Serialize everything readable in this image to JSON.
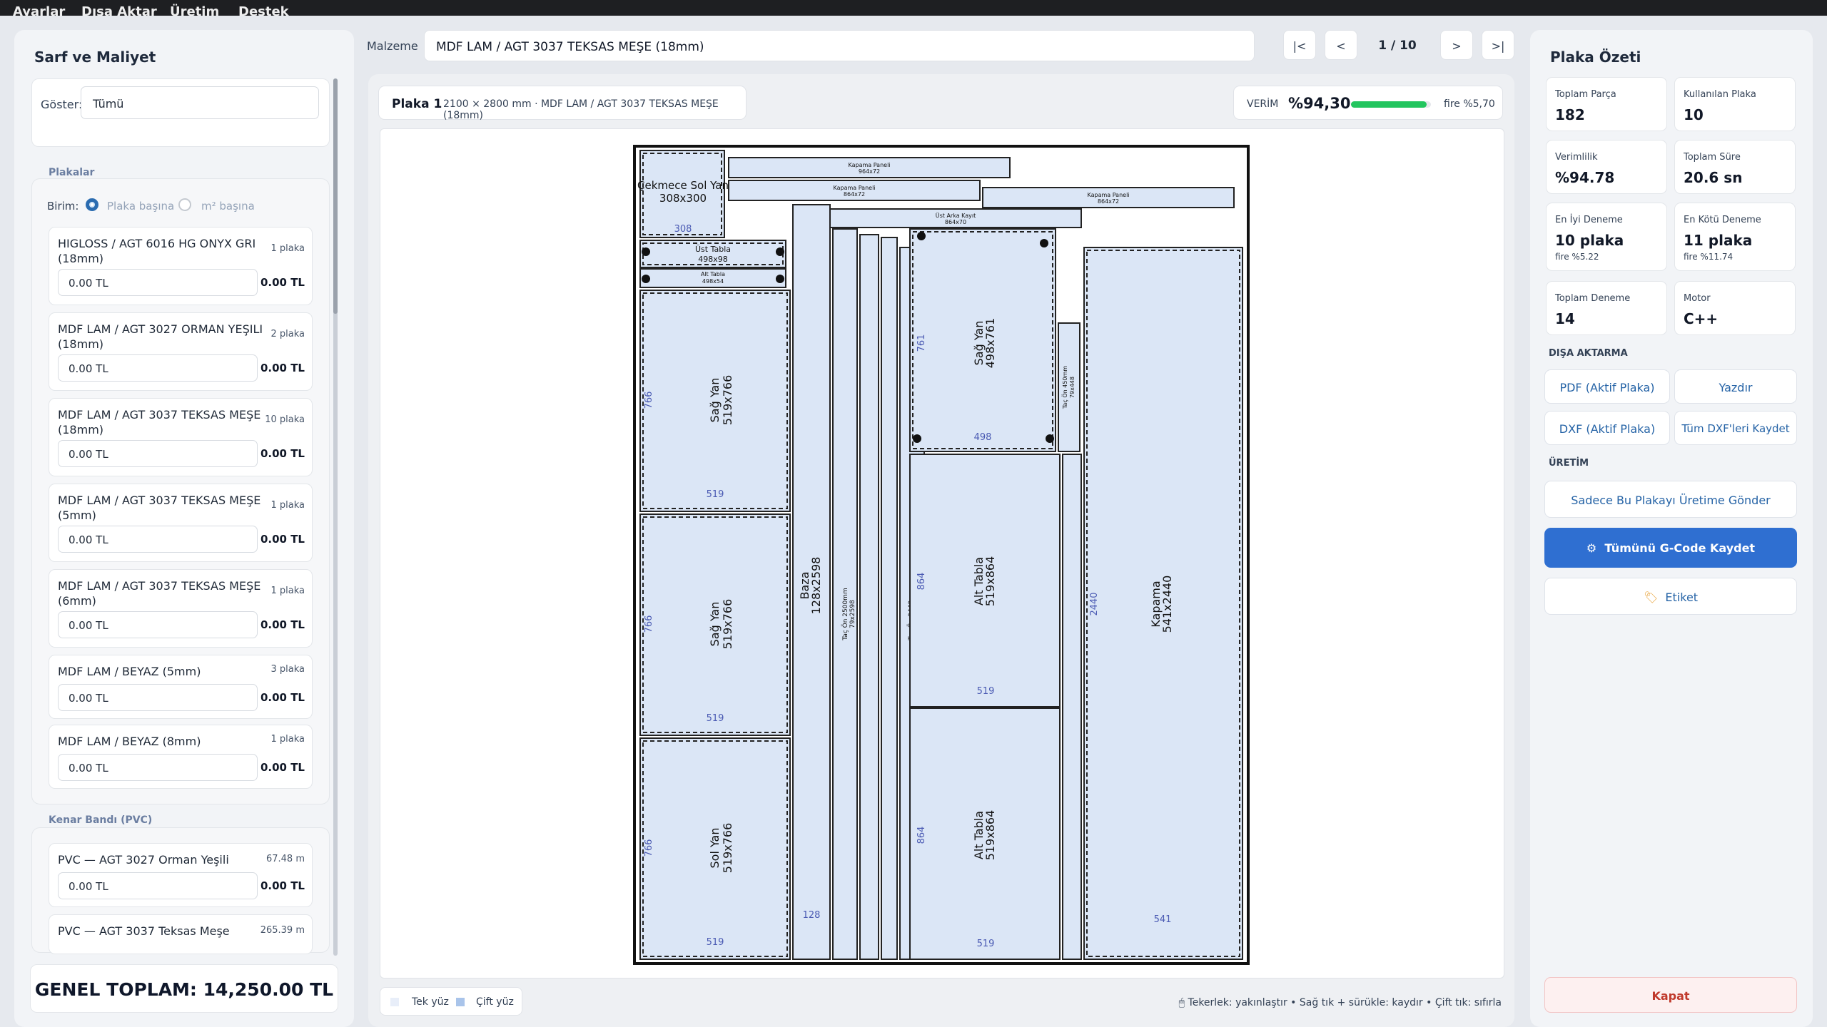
{
  "menu": [
    "Ayarlar",
    "Dışa Aktar",
    "Üretim",
    "Destek"
  ],
  "left": {
    "title": "Sarf ve Maliyet",
    "filter_label": "Göster:",
    "filter_value": "Tümü",
    "plates_section": "Plakalar",
    "unit_label": "Birim:",
    "unit_options": [
      "Plaka başına",
      "m² başına"
    ],
    "materials": [
      {
        "name": "HIGLOSS / AGT 6016 HG ONYX GRI (18mm)",
        "count": "1 plaka",
        "input": "0.00 TL",
        "total": "0.00 TL"
      },
      {
        "name": "MDF LAM / AGT 3027 ORMAN YEŞILI (18mm)",
        "count": "2 plaka",
        "input": "0.00 TL",
        "total": "0.00 TL"
      },
      {
        "name": "MDF LAM / AGT 3037 TEKSAS MEŞE (18mm)",
        "count": "10 plaka",
        "input": "0.00 TL",
        "total": "0.00 TL"
      },
      {
        "name": "MDF LAM / AGT 3037 TEKSAS MEŞE (5mm)",
        "count": "1 plaka",
        "input": "0.00 TL",
        "total": "0.00 TL"
      },
      {
        "name": "MDF LAM / AGT 3037 TEKSAS MEŞE (6mm)",
        "count": "1 plaka",
        "input": "0.00 TL",
        "total": "0.00 TL"
      },
      {
        "name": "MDF LAM / BEYAZ (5mm)",
        "count": "3 plaka",
        "input": "0.00 TL",
        "total": "0.00 TL"
      },
      {
        "name": "MDF LAM / BEYAZ (8mm)",
        "count": "1 plaka",
        "input": "0.00 TL",
        "total": "0.00 TL"
      }
    ],
    "edge_section": "Kenar Bandı (PVC)",
    "edges": [
      {
        "name": "PVC — AGT 3027 Orman Yeşili",
        "count": "67.48 m",
        "input": "0.00 TL",
        "total": "0.00 TL"
      },
      {
        "name": "PVC — AGT 3037 Teksas Meşe",
        "count": "265.39 m",
        "input": "0.00 TL",
        "total": "0.00 TL"
      }
    ],
    "grand_total": "GENEL TOPLAM: 14,250.00 TL"
  },
  "top": {
    "material_label": "Malzeme",
    "material_value": "MDF LAM / AGT 3037 TEKSAS MEŞE (18mm)",
    "nav_first": "|<",
    "nav_prev": "<",
    "page": "1 / 10",
    "nav_next": ">",
    "nav_last": ">|"
  },
  "sheet": {
    "title": "Plaka 1",
    "info": "2100 × 2800 mm · MDF LAM / AGT 3037 TEKSAS MEŞE (18mm)",
    "verim_label": "VERİM",
    "verim_value": "%94,30",
    "verim_fraction": 0.943,
    "fire": "fire %5,70",
    "legend_single": "Tek yüz",
    "legend_double": "Çift yüz",
    "hint1": "Tekerlek: yakınlaştır",
    "hint2": "Sağ tık + sürükle: kaydır",
    "hint3": "Çift tık: sıfırla",
    "pieces": {
      "p1": {
        "name": "Çekmece Sol Yan",
        "dims": "308x300",
        "w": "308"
      },
      "p2": {
        "name": "Kapama Paneli",
        "dims": "964x72"
      },
      "p3": {
        "name": "Kapama Paneli",
        "dims": "864x72"
      },
      "p4": {
        "name": "Kapama Paneli",
        "dims": "864x72"
      },
      "p5": {
        "name": "Üst Arka Kayıt",
        "dims": "864x70"
      },
      "p6": {
        "name": "Üst Tabla",
        "dims": "498x98"
      },
      "p7": {
        "name": "Alt Tabla",
        "dims": "498x54"
      },
      "p8": {
        "name": "Sağ Yan",
        "dims": "519x766",
        "h": "766",
        "w": "519"
      },
      "p9": {
        "name": "Sağ Yan",
        "dims": "519x766",
        "h": "766",
        "w": "519"
      },
      "p10": {
        "name": "Sol Yan",
        "dims": "519x766",
        "h": "766",
        "w": "519"
      },
      "p11": {
        "name": "Baza",
        "dims": "128x2598",
        "w": "128"
      },
      "p12": {
        "name": "Taç Ön 2500mm",
        "dims": "79x2598"
      },
      "p13": {
        "name": "Taç Ön 2442mm",
        "dims": "79x2440"
      },
      "p14": {
        "name": "Sağ Yan",
        "dims": "498x761",
        "h": "761",
        "w": "498"
      },
      "p15": {
        "name": "Taç Ön 450mm",
        "dims": "79x448"
      },
      "p16": {
        "name": "Alt Tabla",
        "dims": "519x864",
        "h": "864",
        "w": "519"
      },
      "p17": {
        "name": "Alt Tabla",
        "dims": "519x864",
        "h": "864",
        "w": "519"
      },
      "p18": {
        "name": "Kapama",
        "dims": "541x2440",
        "h": "2440",
        "w": "541"
      }
    }
  },
  "right": {
    "title": "Plaka Özeti",
    "stats": [
      {
        "label": "Toplam Parça",
        "value": "182"
      },
      {
        "label": "Kullanılan Plaka",
        "value": "10"
      },
      {
        "label": "Verimlilik",
        "value": "%94.78"
      },
      {
        "label": "Toplam Süre",
        "value": "20.6 sn"
      },
      {
        "label": "En İyi Deneme",
        "value": "10 plaka",
        "sub": "fire %5.22"
      },
      {
        "label": "En Kötü Deneme",
        "value": "11 plaka",
        "sub": "fire %11.74"
      },
      {
        "label": "Toplam Deneme",
        "value": "14"
      },
      {
        "label": "Motor",
        "value": "C++"
      }
    ],
    "export_section": "DIŞA AKTARMA",
    "btn_pdf": "PDF (Aktif Plaka)",
    "btn_print": "Yazdır",
    "btn_dxf": "DXF (Aktif Plaka)",
    "btn_dxf_all": "Tüm DXF'leri Kaydet",
    "production_section": "ÜRETİM",
    "btn_send": "Sadece Bu Plakayı Üretime Gönder",
    "btn_gcode": "Tümünü G-Code Kaydet",
    "btn_label": "Etiket",
    "btn_close": "Kapat",
    "accent": "#2f6fd1"
  }
}
